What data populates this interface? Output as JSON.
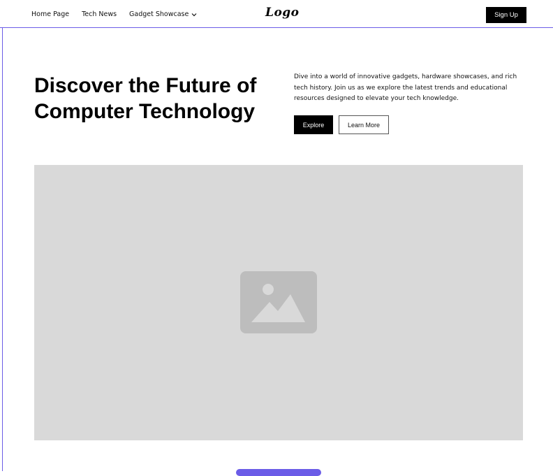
{
  "nav": {
    "items": [
      {
        "label": "Home Page"
      },
      {
        "label": "Tech News"
      },
      {
        "label": "Gadget Showcase"
      }
    ],
    "logo": "Logo",
    "signup_label": "Sign Up"
  },
  "hero": {
    "title": "Discover the Future of Computer Technology",
    "description": "Dive into a world of innovative gadgets, hardware showcases, and rich tech history. Join us as we explore the latest trends and educational resources designed to elevate your tech knowledge.",
    "explore_label": "Explore",
    "learn_more_label": "Learn More",
    "image_icon": "image-placeholder-icon"
  },
  "colors": {
    "accent": "#6b5ce7",
    "primary_button": "#000000",
    "image_placeholder": "#d9d9d9",
    "placeholder_icon": "#bdbdbd"
  }
}
